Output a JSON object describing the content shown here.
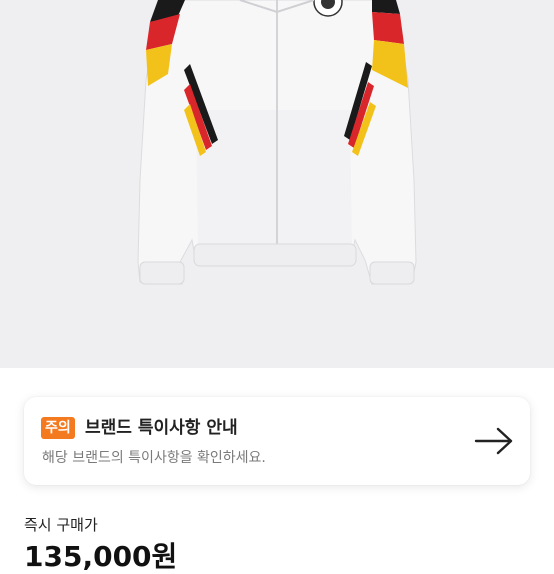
{
  "product": {
    "image_icon": "track-jacket-image"
  },
  "notice": {
    "badge": "주의",
    "title": "브랜드 특이사항 안내",
    "description": "해당 브랜드의 특이사항을 확인하세요.",
    "arrow_icon": "arrow-right-icon",
    "badge_color": "#f47a1f"
  },
  "purchase": {
    "label": "즉시 구매가",
    "price": "135,000원"
  }
}
